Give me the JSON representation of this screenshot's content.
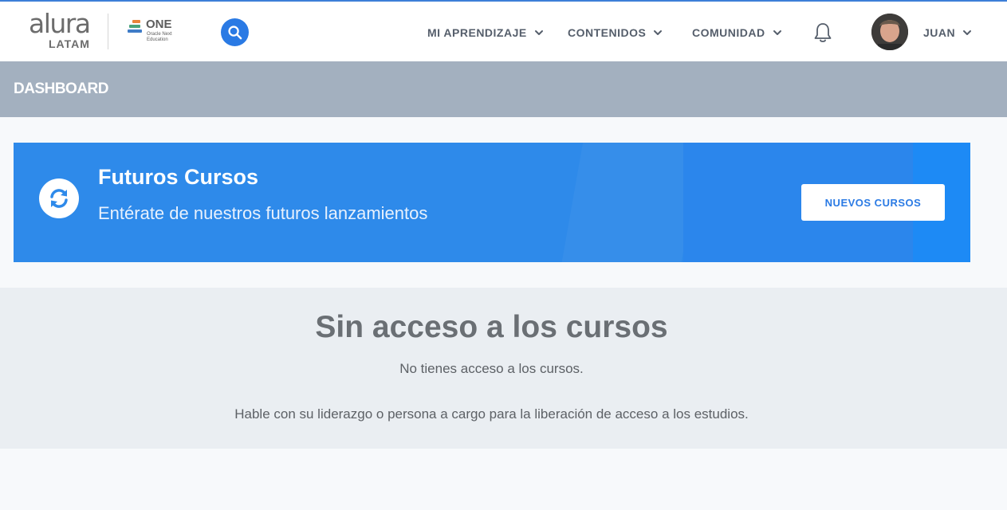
{
  "header": {
    "logo": {
      "word": "alura",
      "sub": "LATAM"
    },
    "partner_logo": {
      "name": "ONE",
      "sub": "Oracle Next Education"
    },
    "nav": [
      {
        "label": "MI APRENDIZAJE"
      },
      {
        "label": "CONTENIDOS"
      },
      {
        "label": "COMUNIDAD"
      }
    ],
    "user": {
      "name": "JUAN"
    }
  },
  "dashboard": {
    "title": "DASHBOARD"
  },
  "banner": {
    "title": "Futuros Cursos",
    "subtitle": "Entérate de nuestros futuros lanzamientos",
    "button_label": "NUEVOS CURSOS"
  },
  "no_access": {
    "title": "Sin acceso a los cursos",
    "message": "No tienes acceso a los cursos.",
    "hint": "Hable con su liderazgo o persona a cargo para la liberación de acceso a los estudios."
  },
  "colors": {
    "accent": "#2a7ae4",
    "banner": "#2e8aea",
    "dashboard_bar": "#a3b0bf"
  }
}
